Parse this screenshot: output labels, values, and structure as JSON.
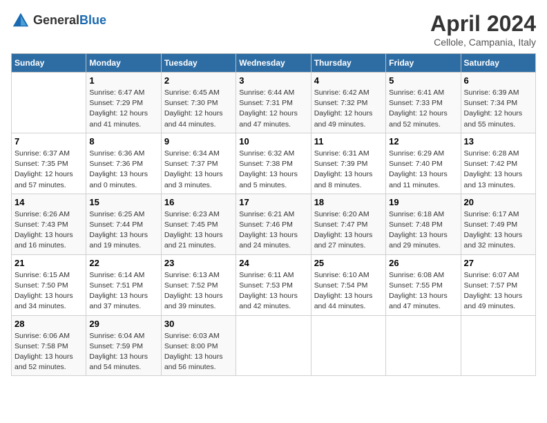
{
  "logo": {
    "general": "General",
    "blue": "Blue"
  },
  "header": {
    "month": "April 2024",
    "location": "Cellole, Campania, Italy"
  },
  "days_of_week": [
    "Sunday",
    "Monday",
    "Tuesday",
    "Wednesday",
    "Thursday",
    "Friday",
    "Saturday"
  ],
  "weeks": [
    [
      {
        "day": "",
        "info": ""
      },
      {
        "day": "1",
        "info": "Sunrise: 6:47 AM\nSunset: 7:29 PM\nDaylight: 12 hours\nand 41 minutes."
      },
      {
        "day": "2",
        "info": "Sunrise: 6:45 AM\nSunset: 7:30 PM\nDaylight: 12 hours\nand 44 minutes."
      },
      {
        "day": "3",
        "info": "Sunrise: 6:44 AM\nSunset: 7:31 PM\nDaylight: 12 hours\nand 47 minutes."
      },
      {
        "day": "4",
        "info": "Sunrise: 6:42 AM\nSunset: 7:32 PM\nDaylight: 12 hours\nand 49 minutes."
      },
      {
        "day": "5",
        "info": "Sunrise: 6:41 AM\nSunset: 7:33 PM\nDaylight: 12 hours\nand 52 minutes."
      },
      {
        "day": "6",
        "info": "Sunrise: 6:39 AM\nSunset: 7:34 PM\nDaylight: 12 hours\nand 55 minutes."
      }
    ],
    [
      {
        "day": "7",
        "info": "Sunrise: 6:37 AM\nSunset: 7:35 PM\nDaylight: 12 hours\nand 57 minutes."
      },
      {
        "day": "8",
        "info": "Sunrise: 6:36 AM\nSunset: 7:36 PM\nDaylight: 13 hours\nand 0 minutes."
      },
      {
        "day": "9",
        "info": "Sunrise: 6:34 AM\nSunset: 7:37 PM\nDaylight: 13 hours\nand 3 minutes."
      },
      {
        "day": "10",
        "info": "Sunrise: 6:32 AM\nSunset: 7:38 PM\nDaylight: 13 hours\nand 5 minutes."
      },
      {
        "day": "11",
        "info": "Sunrise: 6:31 AM\nSunset: 7:39 PM\nDaylight: 13 hours\nand 8 minutes."
      },
      {
        "day": "12",
        "info": "Sunrise: 6:29 AM\nSunset: 7:40 PM\nDaylight: 13 hours\nand 11 minutes."
      },
      {
        "day": "13",
        "info": "Sunrise: 6:28 AM\nSunset: 7:42 PM\nDaylight: 13 hours\nand 13 minutes."
      }
    ],
    [
      {
        "day": "14",
        "info": "Sunrise: 6:26 AM\nSunset: 7:43 PM\nDaylight: 13 hours\nand 16 minutes."
      },
      {
        "day": "15",
        "info": "Sunrise: 6:25 AM\nSunset: 7:44 PM\nDaylight: 13 hours\nand 19 minutes."
      },
      {
        "day": "16",
        "info": "Sunrise: 6:23 AM\nSunset: 7:45 PM\nDaylight: 13 hours\nand 21 minutes."
      },
      {
        "day": "17",
        "info": "Sunrise: 6:21 AM\nSunset: 7:46 PM\nDaylight: 13 hours\nand 24 minutes."
      },
      {
        "day": "18",
        "info": "Sunrise: 6:20 AM\nSunset: 7:47 PM\nDaylight: 13 hours\nand 27 minutes."
      },
      {
        "day": "19",
        "info": "Sunrise: 6:18 AM\nSunset: 7:48 PM\nDaylight: 13 hours\nand 29 minutes."
      },
      {
        "day": "20",
        "info": "Sunrise: 6:17 AM\nSunset: 7:49 PM\nDaylight: 13 hours\nand 32 minutes."
      }
    ],
    [
      {
        "day": "21",
        "info": "Sunrise: 6:15 AM\nSunset: 7:50 PM\nDaylight: 13 hours\nand 34 minutes."
      },
      {
        "day": "22",
        "info": "Sunrise: 6:14 AM\nSunset: 7:51 PM\nDaylight: 13 hours\nand 37 minutes."
      },
      {
        "day": "23",
        "info": "Sunrise: 6:13 AM\nSunset: 7:52 PM\nDaylight: 13 hours\nand 39 minutes."
      },
      {
        "day": "24",
        "info": "Sunrise: 6:11 AM\nSunset: 7:53 PM\nDaylight: 13 hours\nand 42 minutes."
      },
      {
        "day": "25",
        "info": "Sunrise: 6:10 AM\nSunset: 7:54 PM\nDaylight: 13 hours\nand 44 minutes."
      },
      {
        "day": "26",
        "info": "Sunrise: 6:08 AM\nSunset: 7:55 PM\nDaylight: 13 hours\nand 47 minutes."
      },
      {
        "day": "27",
        "info": "Sunrise: 6:07 AM\nSunset: 7:57 PM\nDaylight: 13 hours\nand 49 minutes."
      }
    ],
    [
      {
        "day": "28",
        "info": "Sunrise: 6:06 AM\nSunset: 7:58 PM\nDaylight: 13 hours\nand 52 minutes."
      },
      {
        "day": "29",
        "info": "Sunrise: 6:04 AM\nSunset: 7:59 PM\nDaylight: 13 hours\nand 54 minutes."
      },
      {
        "day": "30",
        "info": "Sunrise: 6:03 AM\nSunset: 8:00 PM\nDaylight: 13 hours\nand 56 minutes."
      },
      {
        "day": "",
        "info": ""
      },
      {
        "day": "",
        "info": ""
      },
      {
        "day": "",
        "info": ""
      },
      {
        "day": "",
        "info": ""
      }
    ]
  ]
}
